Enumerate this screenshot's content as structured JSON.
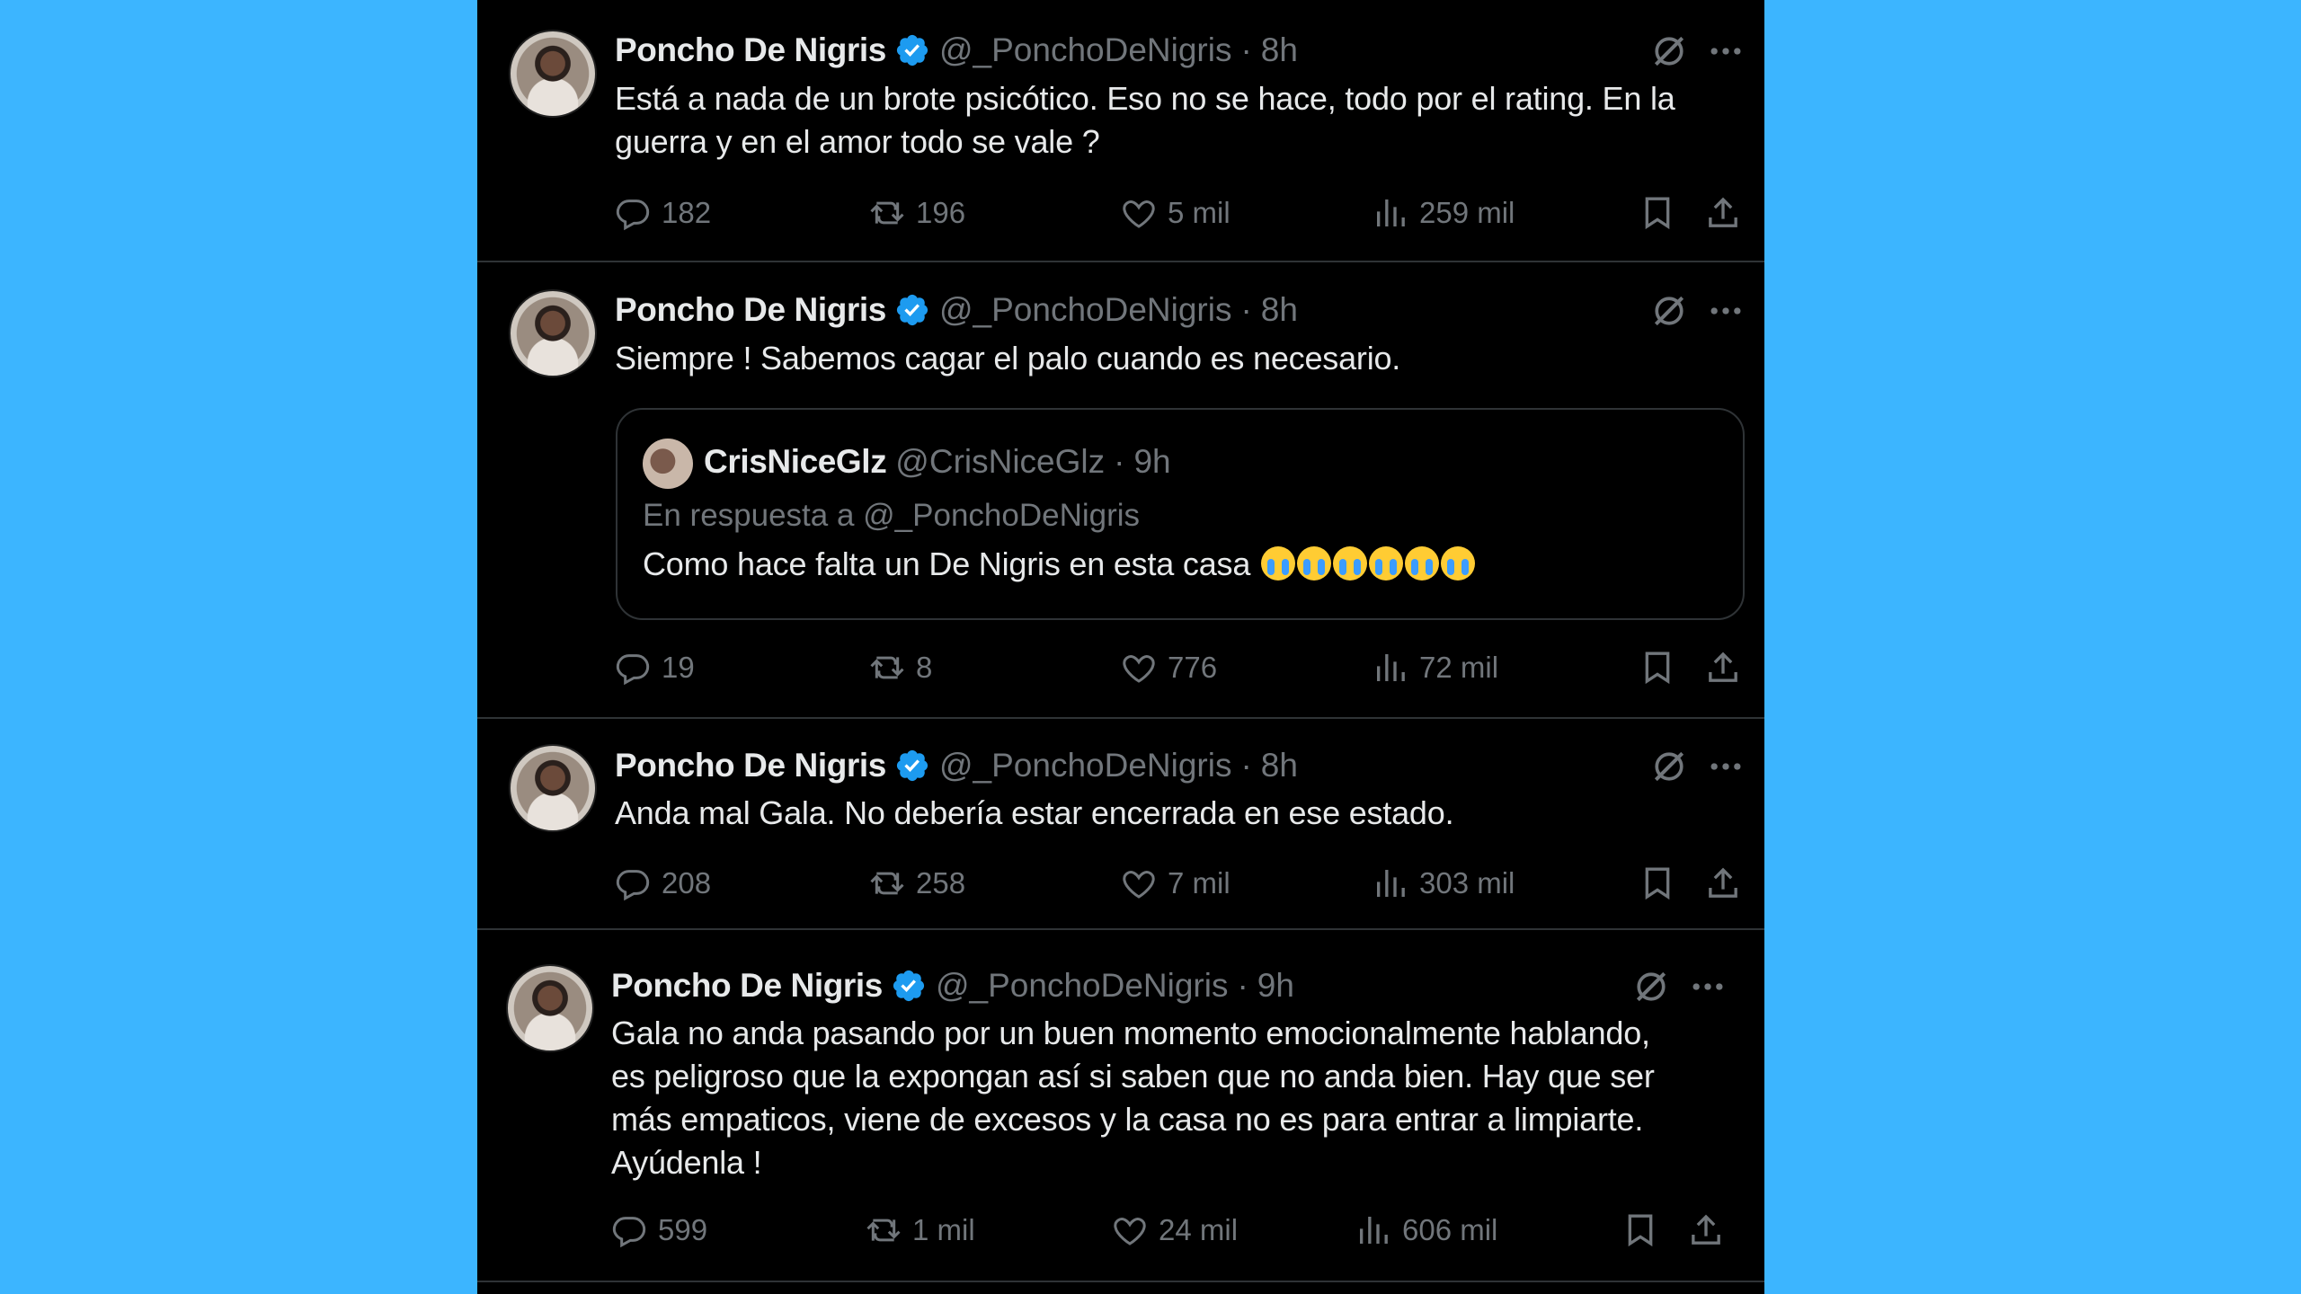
{
  "tweets": [
    {
      "name": "Poncho De Nigris",
      "handle": "@_PonchoDeNigris",
      "time": "8h",
      "text_lines": [
        "Está a nada de un brote psicótico. Eso no se hace, todo por el rating. En la",
        "guerra y en el amor todo se vale ?"
      ],
      "replies": "182",
      "reposts": "196",
      "likes": "5 mil",
      "views": "259 mil"
    },
    {
      "name": "Poncho De Nigris",
      "handle": "@_PonchoDeNigris",
      "time": "8h",
      "text_lines": [
        "Siempre ! Sabemos cagar el palo cuando es necesario."
      ],
      "quote": {
        "name": "CrisNiceGlz",
        "handle": "@CrisNiceGlz",
        "time": "9h",
        "reply_to": "En respuesta a @_PonchoDeNigris",
        "text": "Como hace falta un De Nigris en esta casa"
      },
      "replies": "19",
      "reposts": "8",
      "likes": "776",
      "views": "72 mil"
    },
    {
      "name": "Poncho De Nigris",
      "handle": "@_PonchoDeNigris",
      "time": "8h",
      "text_lines": [
        "Anda mal Gala. No debería estar encerrada en ese estado."
      ],
      "replies": "208",
      "reposts": "258",
      "likes": "7 mil",
      "views": "303 mil"
    },
    {
      "name": "Poncho De Nigris",
      "handle": "@_PonchoDeNigris",
      "time": "9h",
      "text_lines": [
        "Gala no anda pasando por un buen momento emocionalmente hablando,",
        "es peligroso que la expongan así si saben que no anda bien.  Hay que ser",
        "más empaticos, viene de excesos y la casa no es para entrar a limpiarte.",
        "Ayúdenla !"
      ],
      "replies": "599",
      "reposts": "1 mil",
      "likes": "24 mil",
      "views": "606 mil"
    }
  ],
  "colors": {
    "background": "#3cb5ff",
    "feed": "#000000",
    "verified": "#1d9bf0",
    "muted": "#71767b"
  },
  "icons": [
    "verified-badge-icon",
    "grok-icon",
    "more-icon",
    "reply-icon",
    "repost-icon",
    "like-icon",
    "views-icon",
    "bookmark-icon",
    "share-icon",
    "crying-emoji-icon"
  ]
}
